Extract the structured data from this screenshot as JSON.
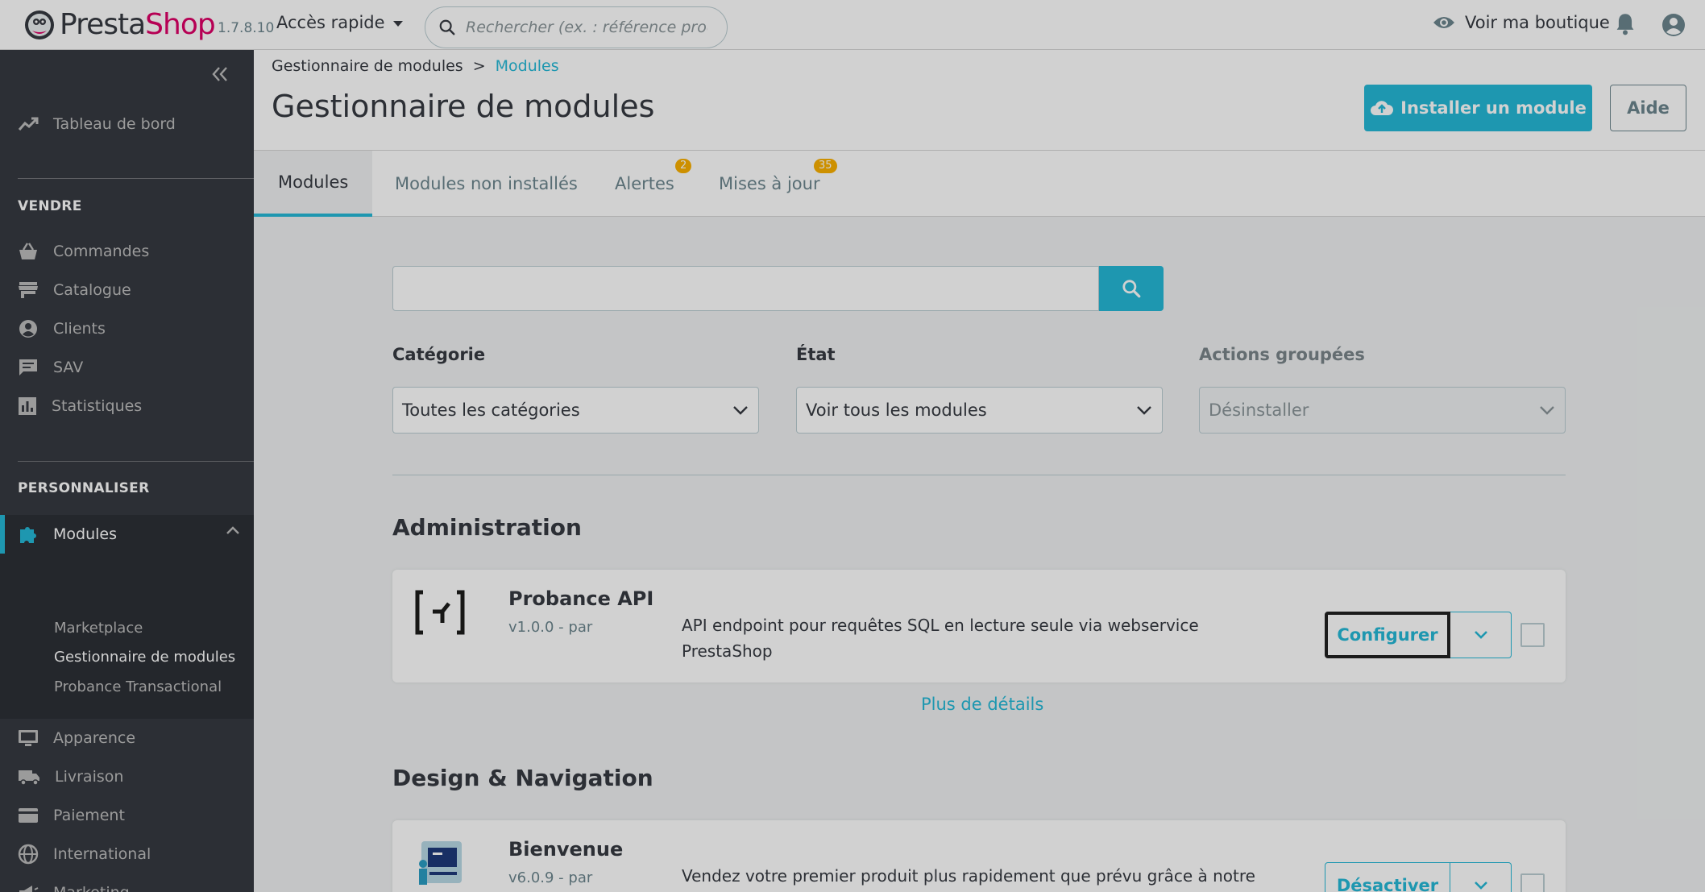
{
  "header": {
    "brand_presta": "Presta",
    "brand_shop": "Shop",
    "version": "1.7.8.10",
    "quick_access": "Accès rapide",
    "search_placeholder": "Rechercher (ex. : référence produit, no",
    "view_shop": "Voir ma boutique"
  },
  "sidebar": {
    "dashboard": "Tableau de bord",
    "section_sell": "VENDRE",
    "sell_items": [
      "Commandes",
      "Catalogue",
      "Clients",
      "SAV",
      "Statistiques"
    ],
    "section_customize": "PERSONNALISER",
    "modules": "Modules",
    "modules_sub": [
      "Marketplace",
      "Gestionnaire de modules",
      "Probance Transactional"
    ],
    "customize_items": [
      "Apparence",
      "Livraison",
      "Paiement",
      "International",
      "Marketing"
    ]
  },
  "page": {
    "breadcrumb_parent": "Gestionnaire de modules",
    "breadcrumb_sep": ">",
    "breadcrumb_current": "Modules",
    "title": "Gestionnaire de modules",
    "install_button": "Installer un module",
    "help_button": "Aide"
  },
  "tabs": [
    {
      "label": "Modules"
    },
    {
      "label": "Modules non installés"
    },
    {
      "label": "Alertes",
      "badge": "2"
    },
    {
      "label": "Mises à jour",
      "badge": "35"
    }
  ],
  "filters": {
    "category_label": "Catégorie",
    "category_value": "Toutes les catégories",
    "state_label": "État",
    "state_value": "Voir tous les modules",
    "bulk_label": "Actions groupées",
    "bulk_value": "Désinstaller"
  },
  "categories": [
    {
      "title": "Administration",
      "module": {
        "name": "Probance API",
        "version": "v1.0.0 - par",
        "description": "API endpoint pour requêtes SQL en lecture seule via webservice PrestaShop",
        "action": "Configurer"
      },
      "more": "Plus de détails"
    },
    {
      "title": "Design & Navigation",
      "module": {
        "name": "Bienvenue",
        "version": "v6.0.9 - par",
        "description": "Vendez votre premier produit plus rapidement que prévu grâce à notre",
        "action": "Désactiver"
      }
    }
  ]
}
